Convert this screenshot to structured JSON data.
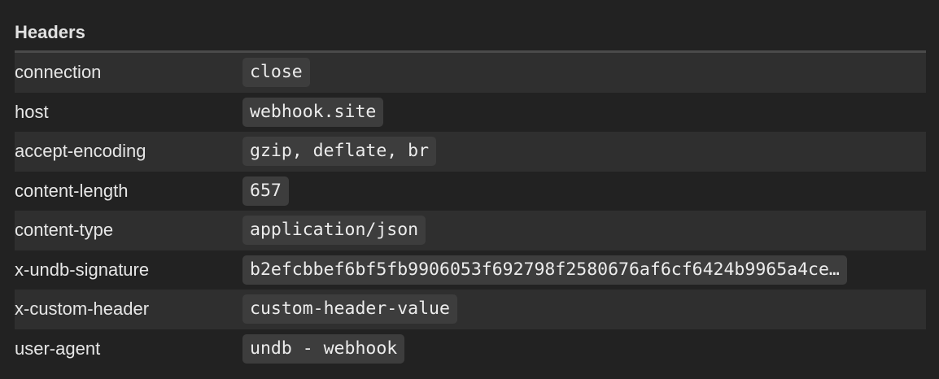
{
  "headers_section": {
    "title": "Headers",
    "rows": [
      {
        "key": "connection",
        "value": "close"
      },
      {
        "key": "host",
        "value": "webhook.site"
      },
      {
        "key": "accept-encoding",
        "value": "gzip, deflate, br"
      },
      {
        "key": "content-length",
        "value": "657"
      },
      {
        "key": "content-type",
        "value": "application/json"
      },
      {
        "key": "x-undb-signature",
        "value": "b2efcbbef6bf5fb9906053f692798f2580676af6cf6424b9965a4ce…"
      },
      {
        "key": "x-custom-header",
        "value": "custom-header-value"
      },
      {
        "key": "user-agent",
        "value": "undb - webhook"
      }
    ]
  },
  "colors": {
    "background": "#222222",
    "row_stripe": "#2f2f2f",
    "value_pill": "#3d3d3d",
    "divider": "#4a4a4a",
    "text": "#e6e6e6"
  }
}
